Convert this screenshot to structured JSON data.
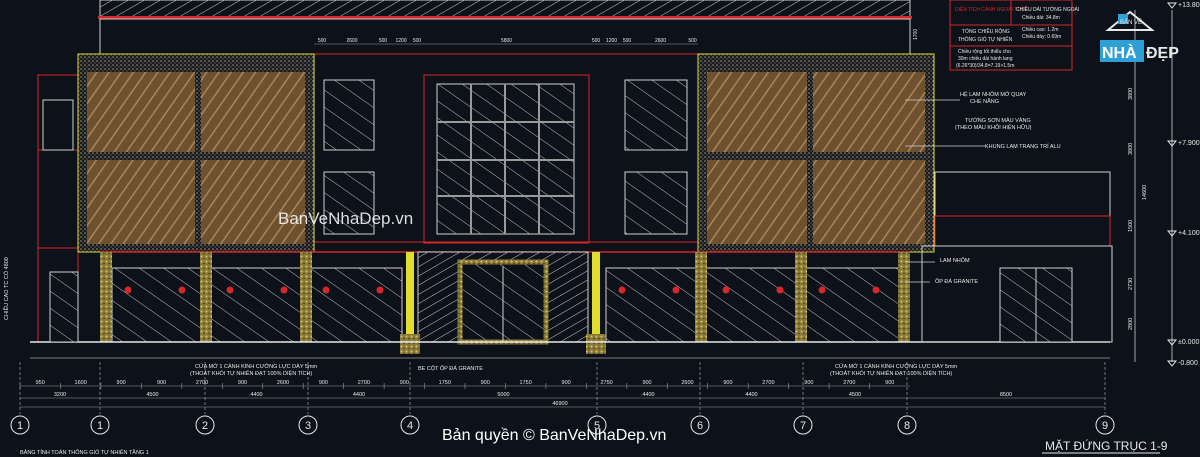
{
  "drawing": {
    "title": "MẶT ĐỨNG TRỤC 1-9",
    "note_bottom_left": "BẢNG TÍNH TOÁN THÔNG GIÓ TỰ NHIÊN TẦNG 1",
    "watermark": "BanVeNhaDep.vn",
    "copyright": "Bản quyền © BanVeNhaDep.vn",
    "height_vertical_label": "CHIỀU CAO TC CỔ 4800",
    "opening_label_left": "CỬA MỞ 1 CÁNH KÍNH CƯỜNG LỰC DÀY 5mm",
    "opening_sub_left": "(THOÁT KHÓI TỰ NHIÊN ĐẠT 100% DIỆN TÍCH)",
    "opening_label_right": "CỬA MỞ 1 CÁNH KÍNH CƯỜNG LỰC DÀY 5mm",
    "opening_sub_right": "(THOÁT KHÓI TỰ NHIÊN ĐẠT 100% DIỆN TÍCH)",
    "column_label": "BE CỘT ỐP ĐÁ GRANITE"
  },
  "logo": {
    "top": "BẢN VẼ",
    "left": "NHÀ",
    "right": "ĐẸP"
  },
  "notes": {
    "red1": "DIỆN TÍCH CÁNH NGOÀI TRỜI",
    "red2": "CHIỀU DÀI TƯỜNG NGOÀI",
    "l1": "Chiều dài: 34.8m",
    "l2": "Chiều cao: 1.2m",
    "l3": "Chiều dày: 0.69m",
    "l4": "TỔNG CHIỀU RỘNG",
    "l5": "THÔNG GIÓ TỰ NHIÊN",
    "l6": "Chiều rộng tối thiểu cho",
    "l7": "30m chiều dài hành lang",
    "l8": "(6.26*30)/34.8=7.19>1.5m",
    "l9": "HỆ LAM NHÔM MỞ QUAY",
    "l10": "CHE NẮNG",
    "l11": "TƯỜNG SƠN MÀU VÀNG",
    "l12": "(THEO MÀU KHỐI HIỆN HỮU)",
    "l13": "KHUNG LAM TRANG TRÍ ALU",
    "l14": "LAM NHÔM",
    "l15": "ỐP ĐÁ GRANITE"
  },
  "levels": [
    "+13.800",
    "+7.900",
    "+4.100",
    "±0.000",
    "-0.800"
  ],
  "right_dims": [
    "3800",
    "3800",
    "14600",
    "1500",
    "2730",
    "2800"
  ],
  "top_dims": [
    "500",
    "2600",
    "500",
    "1200",
    "500",
    "5800",
    "500",
    "1200",
    "500",
    "2600",
    "500"
  ],
  "top_dim_side": "1700",
  "bottom_dims_row1": [
    "950",
    "1600",
    "900",
    "900",
    "2700",
    "900",
    "2600",
    "900",
    "2700",
    "900",
    "1750",
    "900",
    "1750",
    "900",
    "2750",
    "900",
    "2600",
    "900",
    "2700",
    "900",
    "2700",
    "900"
  ],
  "bottom_dims_row2": [
    "3200",
    "4500",
    "4400",
    "4400",
    "5000",
    "4400",
    "4400",
    "4500",
    "8500"
  ],
  "total_length": "46900",
  "axes": [
    "1",
    "1",
    "2",
    "3",
    "4",
    "5",
    "6",
    "7",
    "8",
    "9"
  ],
  "colors": {
    "background": "#0d1119",
    "red": "#d8262a",
    "yellow": "#e0de2c",
    "wood": "#7a5a35",
    "cyan": "#3ec5d6",
    "white": "#e8e8e8"
  }
}
